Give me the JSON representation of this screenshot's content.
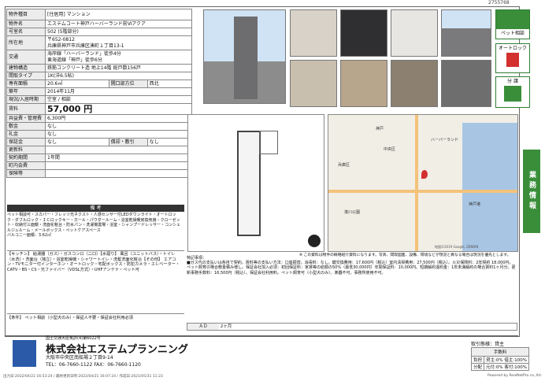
{
  "doc_id": "2755768",
  "property": {
    "category_label": "物件種目",
    "category": "[住居用] マンション",
    "name_label": "物件名",
    "name": "エステムコート神戸ハーバーランド前Ⅵアクア",
    "room_label": "号室名",
    "room": "502 (5階部分)",
    "address_label": "所在地",
    "postal": "〒652-0812",
    "address": "兵庫県神戸市兵庫区湊町１丁目13-1",
    "access_label": "交通",
    "access1": "海岸線「ハーバーランド」徒歩4分",
    "access2": "東海道線「神戸」徒歩6分",
    "structure_label": "建物構造",
    "structure": "鉄筋コンクリート造 地上14階 総戸数156戸",
    "layout_label": "間取タイプ",
    "layout": "1K(洋6.5帖)",
    "area_label": "専有面積",
    "area": "20.6㎡",
    "opening_label": "開口部方位",
    "opening": "西北",
    "built_label": "築年",
    "built": "2014年11月",
    "status_label": "現況/入居時期",
    "status": "空室 / 相談",
    "rent_label": "賃料",
    "rent": "57,000 円",
    "fee_label": "共益費・管理費",
    "fee": "6,300円",
    "deposit_label": "敷金",
    "deposit": "なし",
    "key_money_label": "礼金",
    "key_money": "なし",
    "guarantee_label": "保証金",
    "guarantee": "なし",
    "amortize_label": "償却・敷引",
    "amortize": "なし",
    "renewal_label": "更新料",
    "renewal": "",
    "contract_label": "契約期間",
    "contract": "1年間",
    "parking_label": "町内会費",
    "parking": "",
    "insurance_label": "保険等",
    "insurance": ""
  },
  "remarks": {
    "header": "備 考",
    "line1": "ペット相談可・スカパー・フレッツ光ネクスト・人感センサー付LEDダウンライト・オートロック・ダブルロック・ＩＣロックキー・ホール・パウダールーム・浴室乾燥暖房換気扇・クローゼット・収納付三面鏡・洗面化粧台・防水パン・洗濯機置場・浴室・シャンプードレッサー・コンシェルジュルーム・メールボックス・ペットケアスペース",
    "line2": "バルコニー面積：3.62㎡"
  },
  "equipment": {
    "text": "【キッチン】 給湯器（ガス）・ガスコンロ（二口）【水廻り】 風呂（ユニットバス）・トイレ（水洗）・洗面台（独立）・浴室乾燥機・シャワートイレ・洗髪洗面化粧台【その他】 エアコン・TVモニター付インターホン・オートロック・宅配ボックス・防犯カメラ・エレベーター・CATV・BS・CS・光ファイバー（VDSL方式）・UHFアンテナ・ペット可"
  },
  "conditions": {
    "label": "【条件】",
    "text": "ペット相談（小型犬のみ）・保証人不要・保証会社利用必須"
  },
  "notes": {
    "title": "特記事項：",
    "text": "■ガス代の支払いは各自で契約。賃料等の支払い方法：口座振替。消毒料：なし。鍵交換費用：17,600円（税込）室内清掃費用：27,500円（税込）。火災保険料：2年契約 18,000円。ペット飼育の場合敷金積み増し。保証会社加入必須：初回保証料：家賃等の総額の50%（最低30,000円）年間保証料：10,000円。短期解約違約金：1年未満解約の場合賃料1ヶ月分。更新事務手数料：16,500円（税込）。保証会社利用料。ペット飼育可（小型犬のみ）。楽器不可。事務所使用不可。",
    "ad_label": "ＡＤ",
    "ad_value": "2ヶ月",
    "disclaimer": "※ この資料は物件の概略紹介資料になります。写真、間取図面、設備、環境などが現況と異なる場合は現況を優先とします。"
  },
  "company": {
    "licence": "国土交通大臣免許(4)第6022号",
    "name": "株式会社エステムプランニング",
    "address": "大阪市中央区南船場２丁目9-14",
    "tel": "TEL：06-7660-1122  FAX：06-7660-1120"
  },
  "transaction": {
    "type_label": "取引態様：貸主",
    "fee_head": "手数料",
    "rows": [
      {
        "label": "負担",
        "value": "貸主:0% 借主:100%"
      },
      {
        "label": "分配",
        "value": "元付:0% 客付:100%"
      }
    ]
  },
  "sidebar": {
    "pet_label": "ペット相談",
    "autolock_label": "オートロック",
    "bunjo_label": "分 譲",
    "business_label": "業務情報"
  },
  "map": {
    "labels": [
      "ハーバーランド",
      "神戸",
      "兵庫区",
      "中央区",
      "湊川公園",
      "神戸港"
    ],
    "copyright": "地図©2019 Google, ZENRIN"
  },
  "footer": {
    "left": "出力日:2022/04/22 16:53:24 / 最終更新日時:2022/04/21 16:07:24 / 作成日:2021/05/31 11:23",
    "right": "Powered by RealNetPro co.,ltd."
  }
}
